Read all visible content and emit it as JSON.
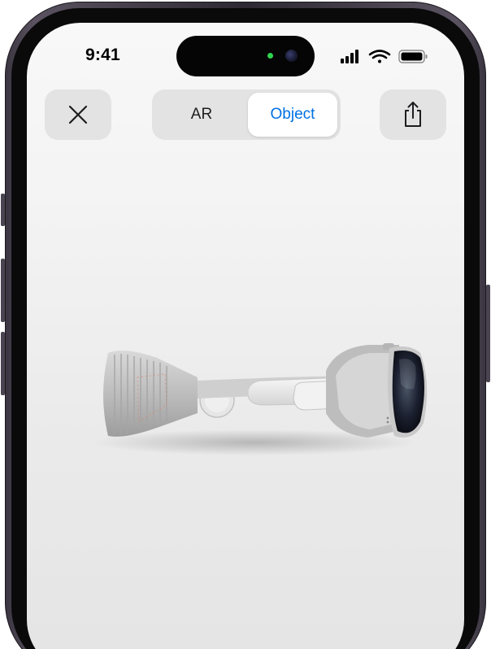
{
  "status_bar": {
    "time": "9:41",
    "icons": [
      "cellular-signal-icon",
      "wifi-icon",
      "battery-icon"
    ]
  },
  "toolbar": {
    "close_icon": "close-icon",
    "segments": [
      {
        "label": "AR",
        "selected": false
      },
      {
        "label": "Object",
        "selected": true
      }
    ],
    "share_icon": "share-icon"
  },
  "colors": {
    "accent": "#0071e3",
    "button_bg": "#e3e3e3",
    "segment_selected_bg": "#ffffff",
    "frame": "#3a3440"
  }
}
